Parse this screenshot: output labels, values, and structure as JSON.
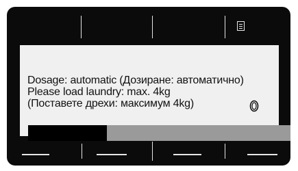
{
  "display": {
    "lines": [
      "Dosage: automatic (Дозиране: автоматично)",
      "Please load laundry: max. 4kg",
      "(Поставете дрехи: максимум 4kg)"
    ],
    "progress": {
      "fraction": 0.3
    },
    "icons": {
      "top_right": "document-icon",
      "status": "ring-icon"
    }
  },
  "colors": {
    "bezel": "#0b0b0b",
    "screen": "#f0f0f0",
    "progress_fill": "#000000",
    "progress_track": "#9a9a9a"
  }
}
